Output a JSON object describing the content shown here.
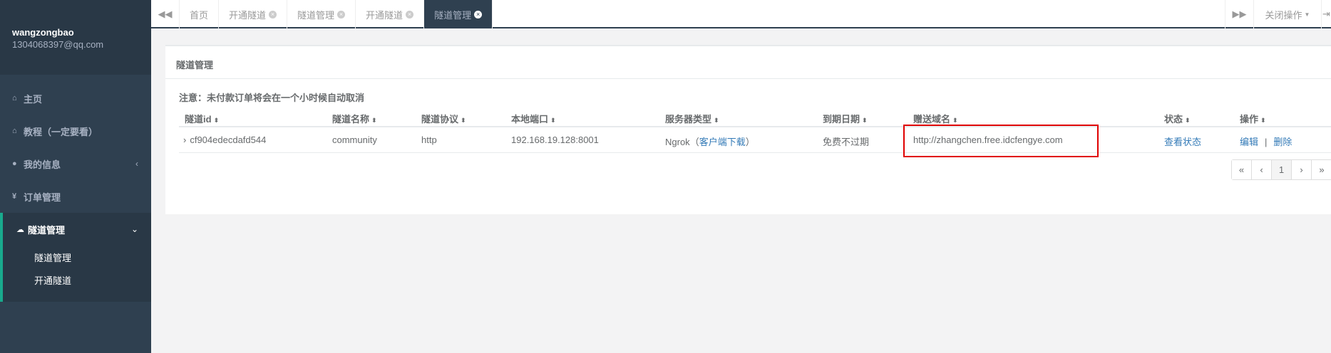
{
  "profile": {
    "username": "wangzongbao",
    "email": "1304068397@qq.com"
  },
  "sidebar": {
    "items": [
      {
        "label": "主页",
        "icon": "home-icon"
      },
      {
        "label": "教程（一定要看）",
        "icon": "home-icon"
      },
      {
        "label": "我的信息",
        "icon": "user-icon",
        "arrow": "‹"
      },
      {
        "label": "订单管理",
        "icon": "yen-icon"
      },
      {
        "label": "隧道管理",
        "icon": "cloud-icon",
        "arrow": "⌄",
        "active": true
      }
    ],
    "sub_items": [
      {
        "label": "隧道管理"
      },
      {
        "label": "开通隧道"
      }
    ]
  },
  "tabs": {
    "items": [
      {
        "label": "首页",
        "closable": false
      },
      {
        "label": "开通隧道",
        "closable": true
      },
      {
        "label": "隧道管理",
        "closable": true
      },
      {
        "label": "开通隧道",
        "closable": true
      },
      {
        "label": "隧道管理",
        "closable": true,
        "active": true
      }
    ],
    "close_ops_label": "关闭操作"
  },
  "panel": {
    "title": "隧道管理",
    "notice": "注意：未付款订单将会在一个小时候自动取消"
  },
  "table": {
    "headers": [
      "隧道id",
      "隧道名称",
      "隧道协议",
      "本地端口",
      "服务器类型",
      "到期日期",
      "赠送域名",
      "状态",
      "操作"
    ],
    "rows": [
      {
        "id": "cf904edecdafd544",
        "name": "community",
        "protocol": "http",
        "local_port": "192.168.19.128:8001",
        "server_type": "Ngrok",
        "server_link": "客户端下载",
        "expiry": "免费不过期",
        "domain": "http://zhangchen.free.idcfengye.com",
        "status_link": "查看状态",
        "edit_label": "编辑",
        "delete_label": "删除"
      }
    ]
  },
  "pagination": {
    "first": "«",
    "prev": "‹",
    "current": "1",
    "next": "›",
    "last": "»"
  },
  "colors": {
    "sidebar_bg": "#2f4050",
    "accent": "#19aa8d",
    "link": "#337ab7",
    "highlight_box": "#e00000"
  }
}
